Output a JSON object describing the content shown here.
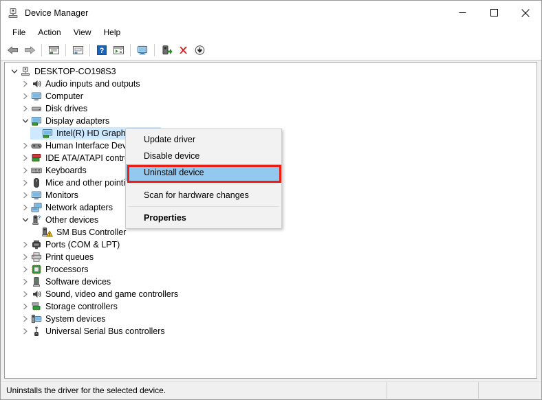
{
  "window": {
    "title": "Device Manager",
    "title_icon": "device-manager-icon",
    "caption": {
      "minimize": "minimize-icon",
      "maximize": "maximize-icon",
      "close": "close-icon"
    }
  },
  "menubar": {
    "items": [
      {
        "label": "File"
      },
      {
        "label": "Action"
      },
      {
        "label": "View"
      },
      {
        "label": "Help"
      }
    ]
  },
  "toolbar": {
    "buttons": [
      {
        "name": "back-arrow-icon"
      },
      {
        "name": "forward-arrow-icon"
      },
      {
        "name": "separator"
      },
      {
        "name": "show-hidden-devices-icon"
      },
      {
        "name": "separator"
      },
      {
        "name": "properties-icon"
      },
      {
        "name": "separator"
      },
      {
        "name": "help-icon"
      },
      {
        "name": "view-details-icon"
      },
      {
        "name": "separator"
      },
      {
        "name": "monitor-icon"
      },
      {
        "name": "separator"
      },
      {
        "name": "scan-hardware-changes-icon"
      },
      {
        "name": "uninstall-device-icon"
      },
      {
        "name": "disable-device-icon"
      }
    ]
  },
  "tree": {
    "nodes": [
      {
        "label": "DESKTOP-CO198S3",
        "level": 0,
        "state": "expanded",
        "icon": "computer-root-icon"
      },
      {
        "label": "Audio inputs and outputs",
        "level": 1,
        "state": "collapsed",
        "icon": "speaker-icon"
      },
      {
        "label": "Computer",
        "level": 1,
        "state": "collapsed",
        "icon": "monitor-icon"
      },
      {
        "label": "Disk drives",
        "level": 1,
        "state": "collapsed",
        "icon": "disk-drive-icon"
      },
      {
        "label": "Display adapters",
        "level": 1,
        "state": "expanded",
        "icon": "display-adapter-icon"
      },
      {
        "label": "Intel(R) HD Graphics 4600",
        "level": 2,
        "state": "leaf",
        "icon": "display-adapter-icon",
        "selected": true
      },
      {
        "label": "Human Interface Devices",
        "level": 1,
        "state": "collapsed",
        "icon": "hid-icon"
      },
      {
        "label": "IDE ATA/ATAPI controllers",
        "level": 1,
        "state": "collapsed",
        "icon": "ide-controller-icon"
      },
      {
        "label": "Keyboards",
        "level": 1,
        "state": "collapsed",
        "icon": "keyboard-icon"
      },
      {
        "label": "Mice and other pointing devices",
        "level": 1,
        "state": "collapsed",
        "icon": "mouse-icon"
      },
      {
        "label": "Monitors",
        "level": 1,
        "state": "collapsed",
        "icon": "monitor-icon"
      },
      {
        "label": "Network adapters",
        "level": 1,
        "state": "collapsed",
        "icon": "network-adapter-icon"
      },
      {
        "label": "Other devices",
        "level": 1,
        "state": "expanded",
        "icon": "unknown-device-icon"
      },
      {
        "label": "SM Bus Controller",
        "level": 2,
        "state": "leaf",
        "icon": "warning-device-icon"
      },
      {
        "label": "Ports (COM & LPT)",
        "level": 1,
        "state": "collapsed",
        "icon": "port-icon"
      },
      {
        "label": "Print queues",
        "level": 1,
        "state": "collapsed",
        "icon": "printer-icon"
      },
      {
        "label": "Processors",
        "level": 1,
        "state": "collapsed",
        "icon": "processor-icon"
      },
      {
        "label": "Software devices",
        "level": 1,
        "state": "collapsed",
        "icon": "software-device-icon"
      },
      {
        "label": "Sound, video and game controllers",
        "level": 1,
        "state": "collapsed",
        "icon": "speaker-icon"
      },
      {
        "label": "Storage controllers",
        "level": 1,
        "state": "collapsed",
        "icon": "storage-controller-icon"
      },
      {
        "label": "System devices",
        "level": 1,
        "state": "collapsed",
        "icon": "system-device-icon"
      },
      {
        "label": "Universal Serial Bus controllers",
        "level": 1,
        "state": "collapsed",
        "icon": "usb-icon"
      }
    ]
  },
  "context_menu": {
    "items": [
      {
        "label": "Update driver",
        "type": "item"
      },
      {
        "label": "Disable device",
        "type": "item"
      },
      {
        "label": "Uninstall device",
        "type": "item",
        "highlighted": true
      },
      {
        "type": "separator"
      },
      {
        "label": "Scan for hardware changes",
        "type": "item"
      },
      {
        "type": "separator"
      },
      {
        "label": "Properties",
        "type": "item",
        "bold": true
      }
    ]
  },
  "statusbar": {
    "message": "Uninstalls the driver for the selected device.",
    "cell2": "",
    "cell3": ""
  },
  "colors": {
    "highlight_blue": "#93c9ef",
    "selection_blue": "#cde8ff",
    "annotation_red": "#ee1c11",
    "window_chrome": "#f0f0f0"
  }
}
